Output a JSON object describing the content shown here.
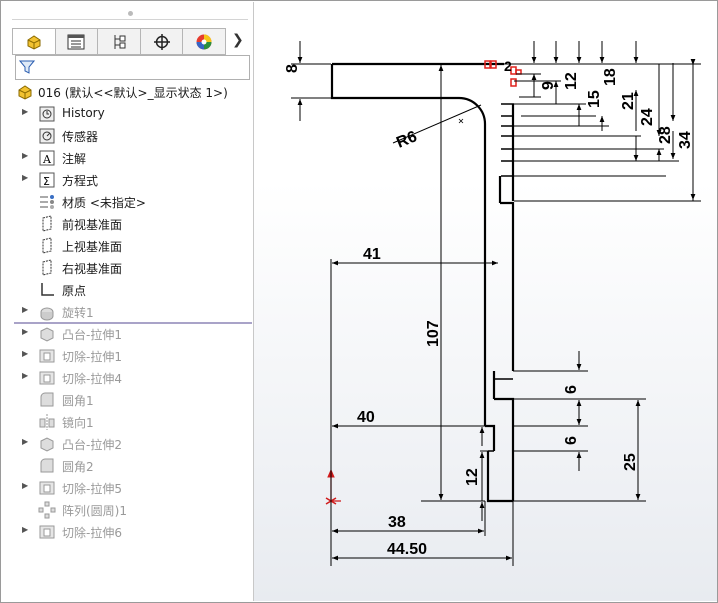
{
  "feature_tree": {
    "root_label": "016  (默认<<默认>_显示状态 1>)",
    "items": [
      {
        "label": "History",
        "expander": true,
        "dim": false,
        "icon": "history-icon"
      },
      {
        "label": "传感器",
        "expander": false,
        "dim": false,
        "icon": "sensor-icon"
      },
      {
        "label": "注解",
        "expander": true,
        "dim": false,
        "icon": "annotation-icon"
      },
      {
        "label": "方程式",
        "expander": true,
        "dim": false,
        "icon": "equation-icon"
      },
      {
        "label": "材质 <未指定>",
        "expander": false,
        "dim": false,
        "icon": "material-icon"
      },
      {
        "label": "前视基准面",
        "expander": false,
        "dim": false,
        "icon": "plane-icon"
      },
      {
        "label": "上视基准面",
        "expander": false,
        "dim": false,
        "icon": "plane-icon"
      },
      {
        "label": "右视基准面",
        "expander": false,
        "dim": false,
        "icon": "plane-icon"
      },
      {
        "label": "原点",
        "expander": false,
        "dim": false,
        "icon": "origin-icon"
      },
      {
        "label": "旋转1",
        "expander": true,
        "dim": true,
        "icon": "revolve-icon"
      },
      {
        "label": "凸台-拉伸1",
        "expander": true,
        "dim": true,
        "icon": "boss-extrude-icon"
      },
      {
        "label": "切除-拉伸1",
        "expander": true,
        "dim": true,
        "icon": "cut-extrude-icon"
      },
      {
        "label": "切除-拉伸4",
        "expander": true,
        "dim": true,
        "icon": "cut-extrude-icon"
      },
      {
        "label": "圆角1",
        "expander": false,
        "dim": true,
        "icon": "fillet-icon"
      },
      {
        "label": "镜向1",
        "expander": false,
        "dim": true,
        "icon": "mirror-icon"
      },
      {
        "label": "凸台-拉伸2",
        "expander": true,
        "dim": true,
        "icon": "boss-extrude-icon"
      },
      {
        "label": "圆角2",
        "expander": false,
        "dim": true,
        "icon": "fillet-icon"
      },
      {
        "label": "切除-拉伸5",
        "expander": true,
        "dim": true,
        "icon": "cut-extrude-icon"
      },
      {
        "label": "阵列(圆周)1",
        "expander": false,
        "dim": true,
        "icon": "pattern-icon"
      },
      {
        "label": "切除-拉伸6",
        "expander": true,
        "dim": true,
        "icon": "cut-extrude-icon"
      }
    ]
  },
  "tabs": [
    {
      "name": "featuremanager-tab",
      "icon": "part-icon"
    },
    {
      "name": "propertymanager-tab",
      "icon": "property-icon"
    },
    {
      "name": "configurationmanager-tab",
      "icon": "config-icon"
    },
    {
      "name": "dimxpert-tab",
      "icon": "crosshair-icon"
    },
    {
      "name": "display-manager-tab",
      "icon": "appearance-icon"
    }
  ],
  "sketch_dims": {
    "d8": "8",
    "d2": "2",
    "d9": "9",
    "d12a": "12",
    "d15": "15",
    "d18": "18",
    "d21": "21",
    "d24": "24",
    "d28": "28",
    "d34": "34",
    "r6": "R6",
    "d41": "41",
    "d107": "107",
    "d40": "40",
    "d6a": "6",
    "d6b": "6",
    "d25": "25",
    "d12b": "12",
    "d38": "38",
    "d4450": "44.50"
  }
}
